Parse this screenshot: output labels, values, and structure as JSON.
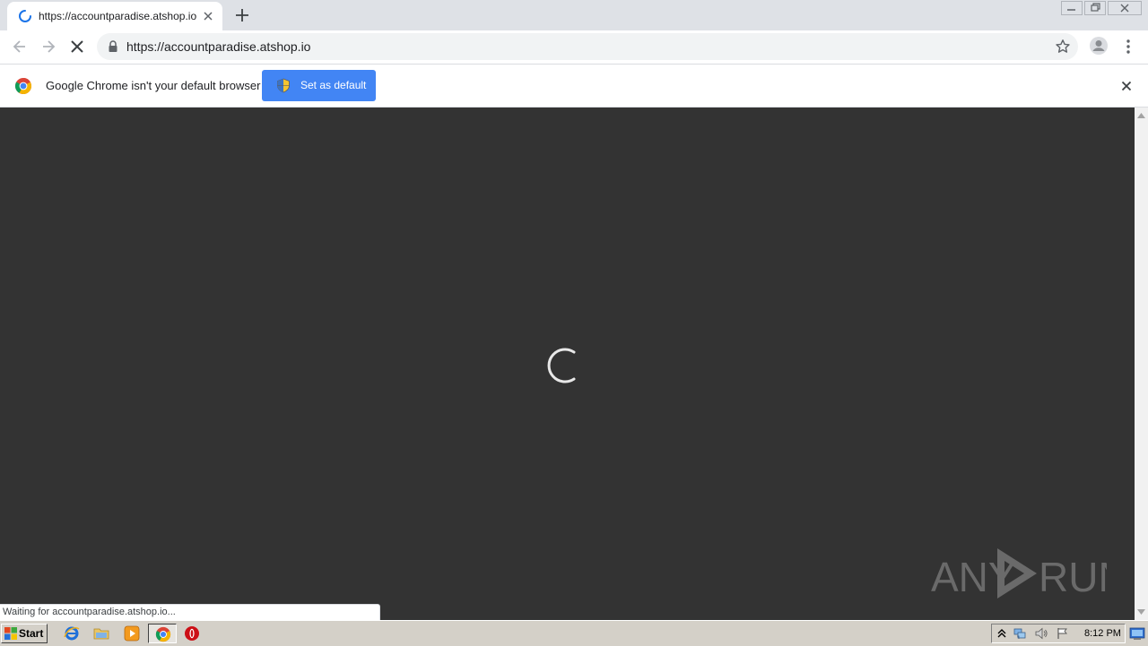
{
  "browser": {
    "tab": {
      "title": "https://accountparadise.atshop.io"
    },
    "address_bar": {
      "url": "https://accountparadise.atshop.io"
    }
  },
  "infobar": {
    "message": "Google Chrome isn't your default browser",
    "button_label": "Set as default"
  },
  "status_bar": {
    "text": "Waiting for accountparadise.atshop.io..."
  },
  "page": {
    "background": "#333333",
    "watermark": {
      "left_text": "ANY",
      "right_text": "RUN"
    }
  },
  "taskbar": {
    "start_label": "Start",
    "pinned": [
      "ie-icon",
      "explorer-icon",
      "media-player-icon",
      "chrome-icon",
      "opera-icon"
    ],
    "clock": "8:12 PM"
  },
  "colors": {
    "accent": "#4285f4",
    "tabstrip": "#dee1e6",
    "taskbar": "#d4d0c8"
  }
}
